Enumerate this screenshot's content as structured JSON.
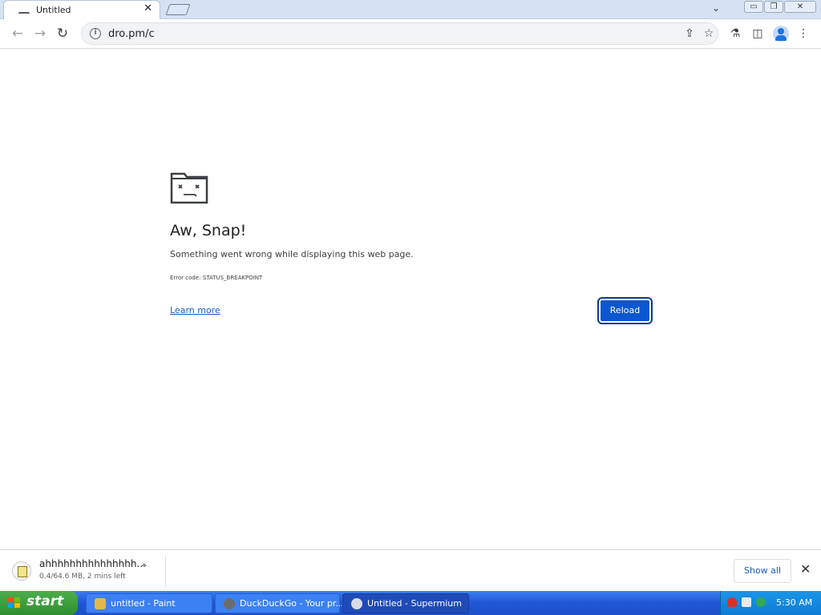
{
  "browser": {
    "tab_title": "Untitled",
    "tab_close": "✕",
    "url": "dro.pm/c",
    "tab_dropdown": "⌄"
  },
  "toolbar": {
    "back": "←",
    "forward": "→",
    "reload": "↻",
    "info": "i",
    "share": "⇪",
    "bookmark": "☆",
    "labs": "⚗",
    "side_panel": "◫",
    "menu": "⋮"
  },
  "window_controls": {
    "minimize": "▭",
    "restore": "❐",
    "close": "✕"
  },
  "error_page": {
    "heading": "Aw, Snap!",
    "message": "Something went wrong while displaying this web page.",
    "error_code": "Error code: STATUS_BREAKPOINT",
    "learn_more": "Learn more",
    "reload_button": "Reload"
  },
  "download_shelf": {
    "file_name": "ahhhhhhhhhhhhhhh...",
    "status": "0.4/64.6 MB, 2 mins left",
    "chevron": "⌃",
    "show_all": "Show all",
    "close": "✕"
  },
  "taskbar": {
    "start_label": "start",
    "tasks": [
      {
        "label": "untitled - Paint",
        "active": false
      },
      {
        "label": "DuckDuckGo - Your pr...",
        "active": false
      },
      {
        "label": "Untitled - Supermium",
        "active": true
      }
    ],
    "clock": "5:30 AM"
  },
  "colors": {
    "reload_button": "#0b57d0",
    "link": "#1a5cc8",
    "taskbar": "#2157d6",
    "start_button": "#3a9a3a",
    "tray": "#0e7bd6"
  }
}
